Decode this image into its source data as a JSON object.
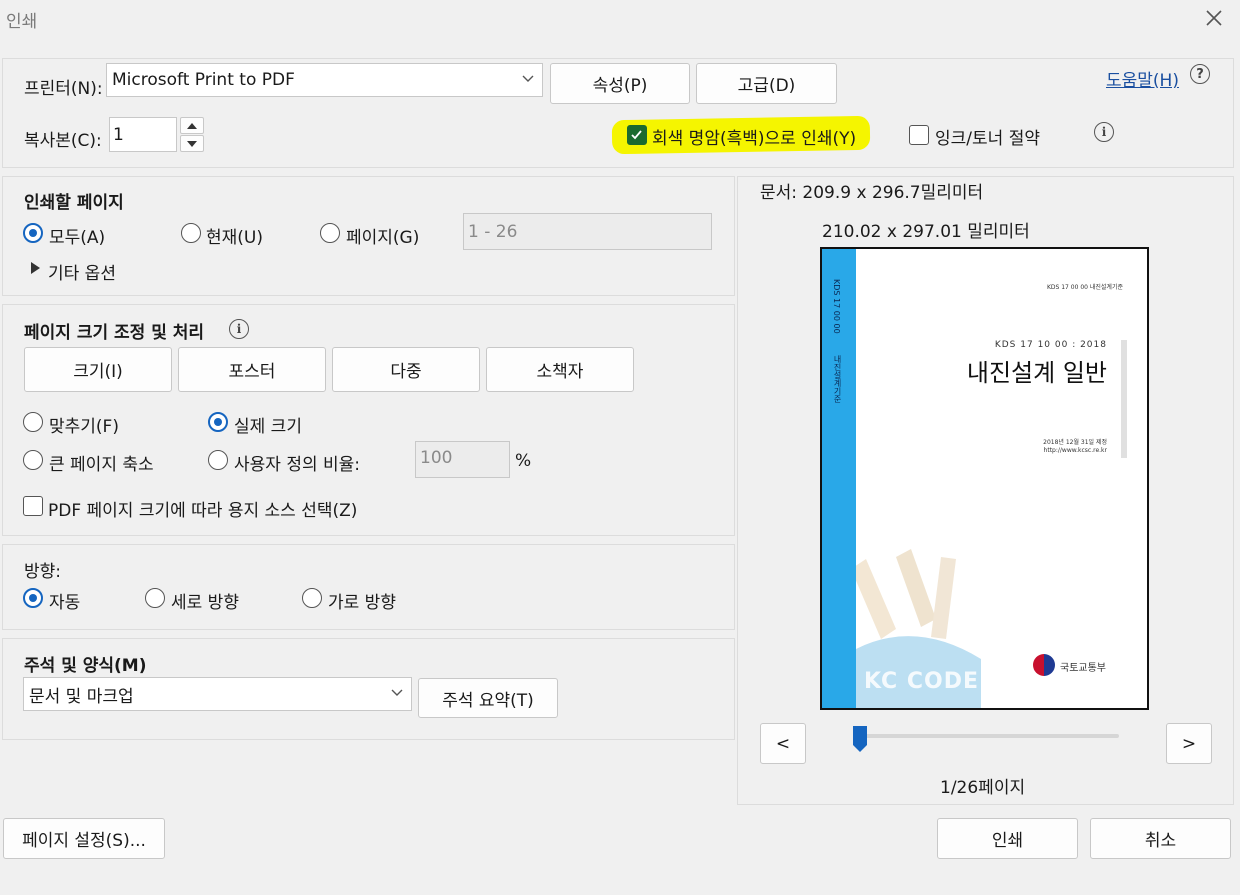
{
  "window": {
    "title": "인쇄"
  },
  "printer": {
    "label": "프린터(N):",
    "selected": "Microsoft Print to PDF",
    "properties_button": "속성(P)",
    "advanced_button": "고급(D)",
    "help_link": "도움말(H)"
  },
  "copies": {
    "label": "복사본(C):",
    "value": "1"
  },
  "options": {
    "grayscale_label": "회색 명암(흑백)으로 인쇄(Y)",
    "grayscale_checked": true,
    "ink_saver_label": "잉크/토너 절약",
    "ink_saver_checked": false
  },
  "pages_to_print": {
    "heading": "인쇄할 페이지",
    "all_label": "모두(A)",
    "current_label": "현재(U)",
    "pages_label": "페이지(G)",
    "range_placeholder": "1 - 26",
    "selected": "all",
    "more_options_label": "기타 옵션"
  },
  "page_sizing": {
    "heading": "페이지 크기 조정 및 처리",
    "tabs": [
      "크기(I)",
      "포스터",
      "다중",
      "소책자"
    ],
    "fit_label": "맞추기(F)",
    "actual_size_label": "실제 크기",
    "shrink_label": "큰 페이지 축소",
    "custom_scale_label": "사용자 정의 비율:",
    "custom_scale_value": "100",
    "percent_sign": "%",
    "selected": "actual_size",
    "paper_source_label": "PDF 페이지 크기에 따라 용지 소스 선택(Z)",
    "paper_source_checked": false
  },
  "orientation": {
    "heading": "방향:",
    "auto_label": "자동",
    "portrait_label": "세로 방향",
    "landscape_label": "가로 방향",
    "selected": "auto"
  },
  "comments": {
    "heading": "주석 및 양식(M)",
    "selected": "문서 및 마크업",
    "summary_button": "주석 요약(T)"
  },
  "preview": {
    "document_size": "문서: 209.9 x 296.7밀리미터",
    "paper_size": "210.02 x 297.01 밀리미터",
    "page_header": "KDS 17 00 00 내진설계기준",
    "page_code": "KDS 17 10 00 : 2018",
    "page_title": "내진설계 일반",
    "page_date": "2018년 12월 31일 제정",
    "page_url": "http://www.kcsc.re.kr",
    "side_text_1": "KDS 17 00 00",
    "side_text_2": "내진설계기준",
    "brand_text": "KC CODE",
    "ministry_text": "국토교통부",
    "prev_button": "<",
    "next_button": ">",
    "current_page": 1,
    "total_pages": 26,
    "page_indicator": "1/26페이지"
  },
  "footer": {
    "page_setup_button": "페이지 설정(S)...",
    "print_button": "인쇄",
    "cancel_button": "취소"
  },
  "colors": {
    "accent": "#1565c0",
    "highlight": "#f5f500",
    "preview_stripe": "#29a8e8"
  }
}
